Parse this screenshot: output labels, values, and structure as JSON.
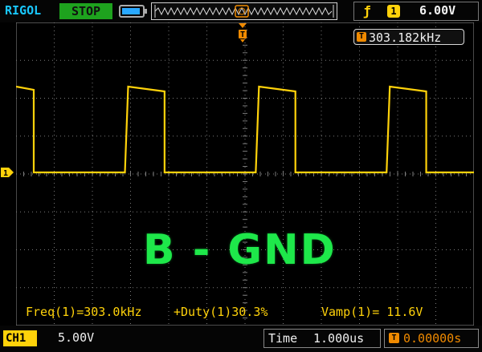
{
  "header": {
    "brand": "RIGOL",
    "run_state": "STOP",
    "trigger": {
      "edge_icon": "rising-edge-icon",
      "channel": "1",
      "level": "6.00V"
    }
  },
  "display": {
    "frequency_counter": {
      "marker": "T",
      "value": "303.182kHz"
    },
    "trigger_position_marker": "T",
    "channel_marker": "1",
    "overlay_label": "B - GND",
    "waveform": {
      "type": "square",
      "duty_percent": 30.3,
      "cycles_visible": 3.5
    },
    "measurements": {
      "freq": "Freq(1)=303.0kHz",
      "duty": "+Duty(1)30.3%",
      "vamp": "Vamp(1)= 11.6V"
    }
  },
  "footer": {
    "channel_tag": "CH1",
    "channel_scale": "5.00V",
    "time_label": "Time",
    "time_value": "1.000us",
    "offset_marker": "T",
    "offset_value": "0.00000s"
  },
  "colors": {
    "trace": "#ffd20a",
    "grid": "#7a7a7a",
    "overlay": "#1ee84a",
    "brand": "#19c8ff",
    "run_state_bg": "#1ea21e",
    "trigger_marker": "#f08a00"
  }
}
